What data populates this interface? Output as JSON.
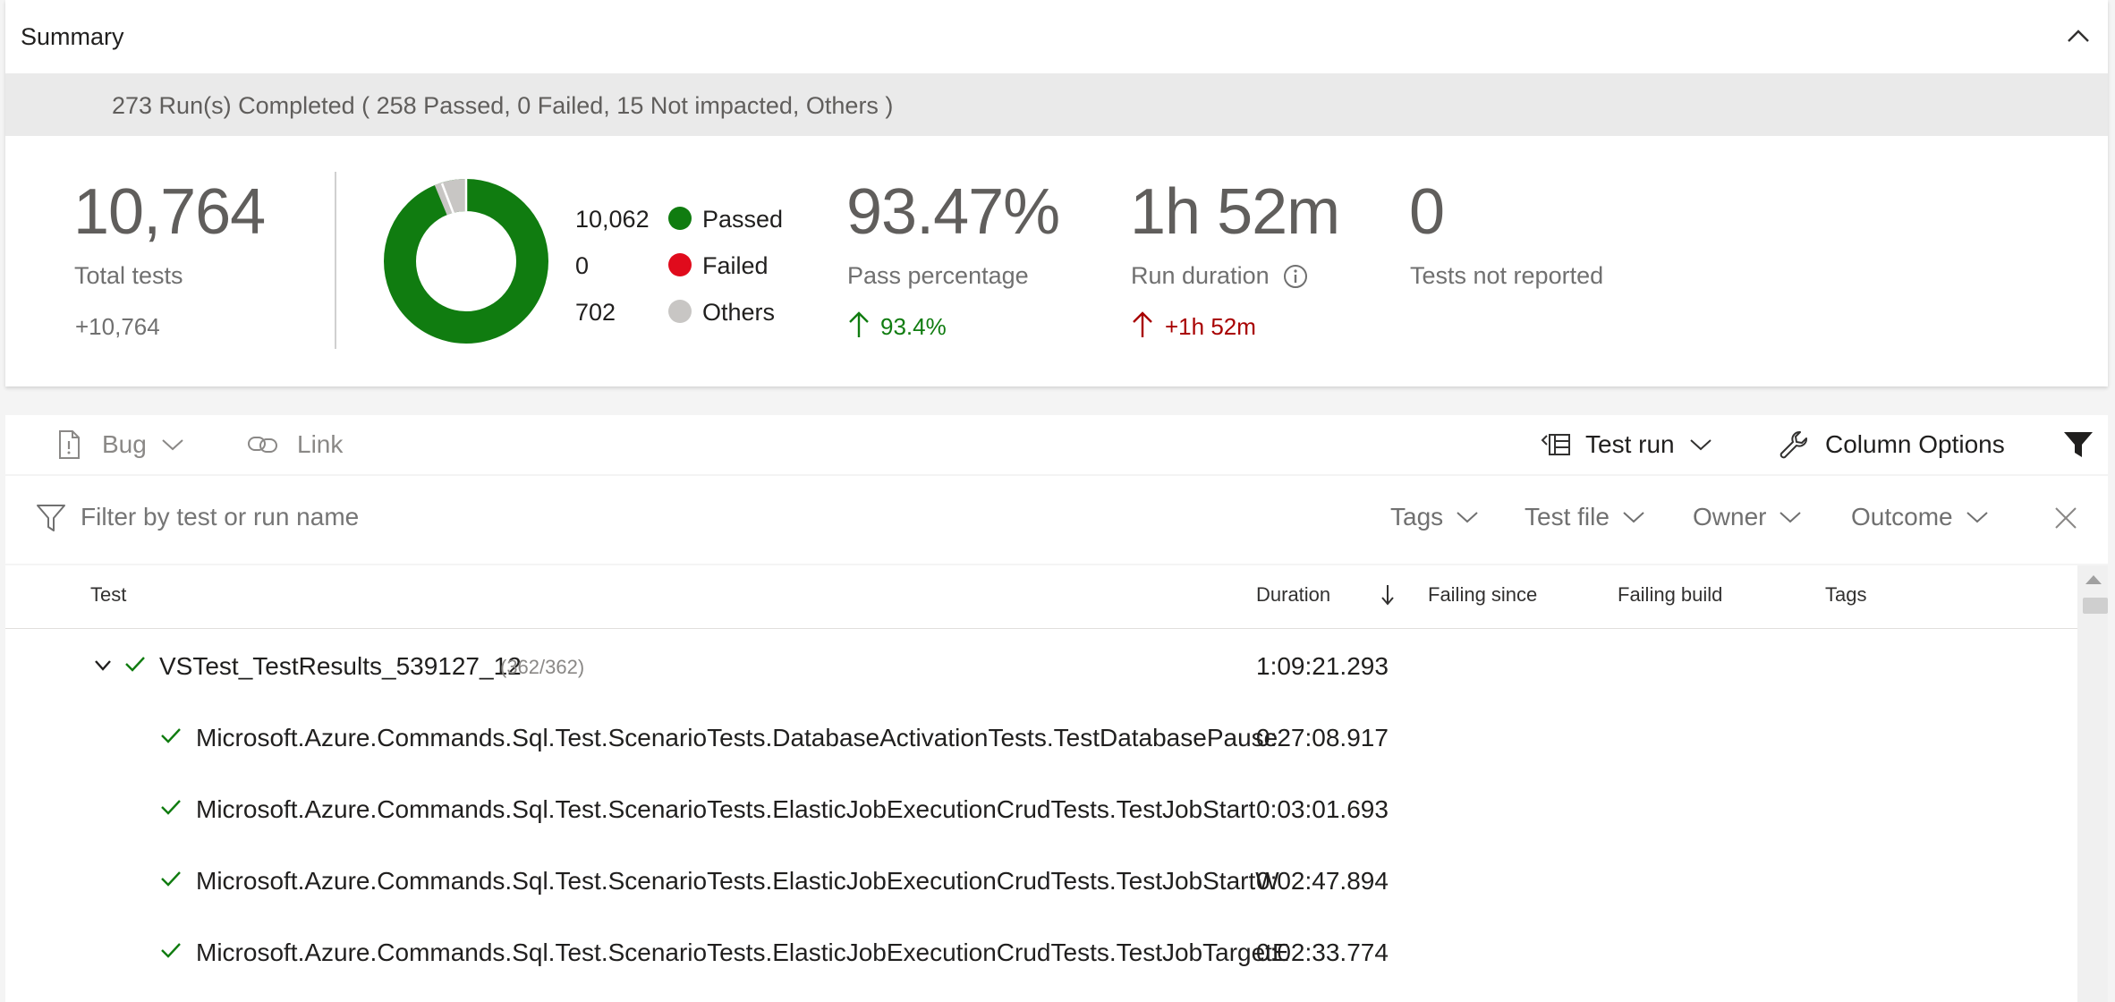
{
  "summary": {
    "title": "Summary",
    "run_banner": "273 Run(s) Completed ( 258 Passed, 0 Failed, 15 Not impacted, Others )",
    "total_tests": {
      "value": "10,764",
      "label": "Total tests",
      "delta": "+10,764"
    },
    "donut": {
      "legend": [
        {
          "count": "10,062",
          "label": "Passed",
          "color": "#107c10"
        },
        {
          "count": "0",
          "label": "Failed",
          "color": "#e00b1c"
        },
        {
          "count": "702",
          "label": "Others",
          "color": "#c8c6c4"
        }
      ]
    },
    "pass_percentage": {
      "value": "93.47%",
      "label": "Pass percentage",
      "delta": "93.4%",
      "delta_color": "#107c10"
    },
    "run_duration": {
      "value": "1h 52m",
      "label": "Run duration",
      "delta": "+1h 52m",
      "delta_color": "#a80000"
    },
    "tests_not_reported": {
      "value": "0",
      "label": "Tests not reported"
    }
  },
  "toolbar": {
    "bug_label": "Bug",
    "link_label": "Link",
    "test_run_label": "Test run",
    "column_options_label": "Column Options"
  },
  "filter": {
    "placeholder": "Filter by test or run name",
    "dropdowns": [
      "Tags",
      "Test file",
      "Owner",
      "Outcome"
    ]
  },
  "table": {
    "headers": {
      "test": "Test",
      "duration": "Duration",
      "failing_since": "Failing since",
      "failing_build": "Failing build",
      "tags": "Tags"
    },
    "group": {
      "name": "VSTest_TestResults_539127_12",
      "count": "(362/362)",
      "duration": "1:09:21.293"
    },
    "rows": [
      {
        "name": "Microsoft.Azure.Commands.Sql.Test.ScenarioTests.DatabaseActivationTests.TestDatabasePause",
        "duration": "0:27:08.917"
      },
      {
        "name": "Microsoft.Azure.Commands.Sql.Test.ScenarioTests.ElasticJobExecutionCrudTests.TestJobStart",
        "duration": "0:03:01.693"
      },
      {
        "name": "Microsoft.Azure.Commands.Sql.Test.ScenarioTests.ElasticJobExecutionCrudTests.TestJobStartW",
        "duration": "0:02:47.894"
      },
      {
        "name": "Microsoft.Azure.Commands.Sql.Test.ScenarioTests.ElasticJobExecutionCrudTests.TestJobTargetE",
        "duration": "0:02:33.774"
      }
    ]
  },
  "colors": {
    "passed": "#107c10",
    "failed": "#e00b1c",
    "others": "#c8c6c4"
  }
}
